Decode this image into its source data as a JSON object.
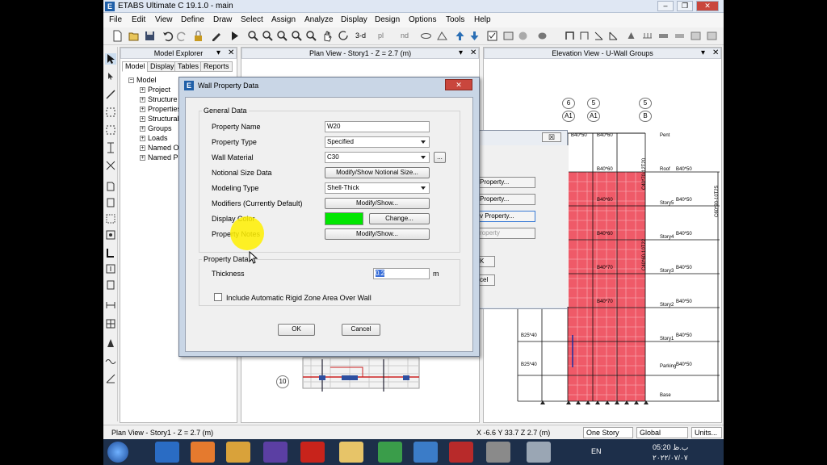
{
  "window": {
    "title": "ETABS Ultimate C 19.1.0 - main",
    "logo": "E"
  },
  "menu": [
    "File",
    "Edit",
    "View",
    "Define",
    "Draw",
    "Select",
    "Assign",
    "Analyze",
    "Display",
    "Design",
    "Options",
    "Tools",
    "Help"
  ],
  "toolbar": {
    "view3d": "3-d",
    "plan": "pl",
    "elev": "nd"
  },
  "explorer": {
    "title": "Model Explorer",
    "tabs": [
      "Model",
      "Display",
      "Tables",
      "Reports"
    ],
    "root": "Model",
    "items": [
      "Project",
      "Structure L",
      "Properties",
      "Structural C",
      "Groups",
      "Loads",
      "Named Ou",
      "Named Plo"
    ]
  },
  "plan_view": {
    "title": "Plan View - Story1 - Z = 2.7 (m)",
    "grid_bubble": "10"
  },
  "elevation_view": {
    "title": "Elevation View - U-Wall  Groups",
    "grid_bubbles": [
      {
        "top": "6",
        "bottom": "A1"
      },
      {
        "top": "5",
        "bottom": "A1"
      },
      {
        "top": "5",
        "bottom": "B"
      }
    ],
    "stories": [
      "Pent",
      "Roof",
      "Story5",
      "Story4",
      "Story3",
      "Story2",
      "Story1",
      "Parking",
      "Base"
    ],
    "beam_labels": [
      "B40*50",
      "B40*60",
      "B40*50",
      "B40*60",
      "B40*50",
      "B40*60",
      "B40*50",
      "B40*60",
      "B40*50",
      "B40*70",
      "B40*50",
      "B40*70",
      "B40*50",
      "B25*40",
      "B25*40",
      "B40*50"
    ],
    "col_labels": [
      "C40*60-10T18",
      "C40*70-12T20",
      "C60*90-10T25",
      "C40*60-10T22"
    ]
  },
  "back_dialog": {
    "close": "☒",
    "buttons": [
      "Property...",
      "Property...",
      "v Property...",
      "roperty"
    ],
    "small_buttons": [
      "K",
      "cel"
    ]
  },
  "dialog": {
    "title": "Wall Property Data",
    "logo": "E",
    "close": "✕",
    "general_group": "General Data",
    "rows": {
      "property_name": {
        "label": "Property Name",
        "value": "W20"
      },
      "property_type": {
        "label": "Property Type",
        "value": "Specified"
      },
      "wall_material": {
        "label": "Wall Material",
        "value": "C30",
        "more": "..."
      },
      "notional_size": {
        "label": "Notional Size Data",
        "button": "Modify/Show Notional Size..."
      },
      "modeling_type": {
        "label": "Modeling Type",
        "value": "Shell-Thick"
      },
      "modifiers": {
        "label": "Modifiers (Currently Default)",
        "button": "Modify/Show..."
      },
      "display_color": {
        "label": "Display Color",
        "color": "#00e600",
        "button": "Change..."
      },
      "property_notes": {
        "label": "Property Notes",
        "button": "Modify/Show..."
      }
    },
    "property_group": "Property Data",
    "thickness": {
      "label": "Thickness",
      "value": "0.2",
      "unit": "m"
    },
    "rigid_zone": {
      "label": "Include Automatic Rigid Zone Area Over Wall",
      "checked": false
    },
    "ok": "OK",
    "cancel": "Cancel"
  },
  "status": {
    "left": "Plan View - Story1 - Z = 2.7 (m)",
    "coords": "X -6.6  Y 33.7  Z 2.7 (m)",
    "story": "One Story",
    "coord_sys": "Global",
    "units": "Units..."
  },
  "taskbar": {
    "lang": "EN",
    "time": "05:20 ب.ظ",
    "date": "۲۰۲۲/۰۷/۰۷"
  }
}
